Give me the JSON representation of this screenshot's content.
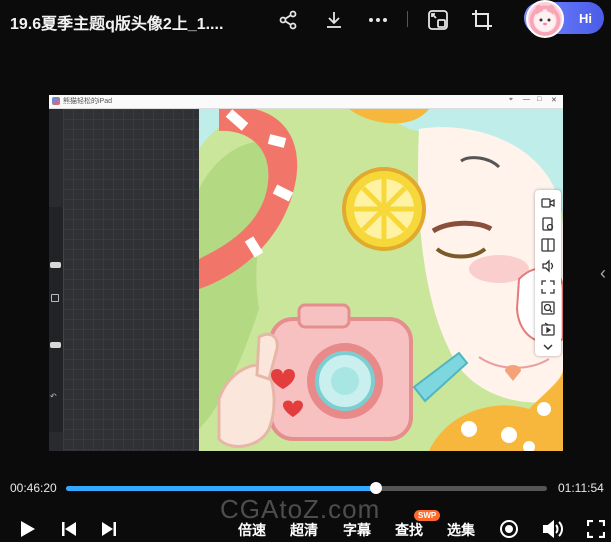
{
  "header": {
    "title": "19.6夏季主题q版头像2上_1....",
    "icons": [
      "share-icon",
      "download-icon",
      "more-icon",
      "pip-icon",
      "fullscreen-window-icon"
    ],
    "assistant_label": "Hi"
  },
  "video": {
    "window_title": "熊猫轻松的iPad",
    "window_controls": [
      "⌖",
      "—",
      "□",
      "✕"
    ]
  },
  "side_toolbar": {
    "icons": [
      "video-record-icon",
      "screenshot-icon",
      "split-icon",
      "volume-icon",
      "expand-icon",
      "zoom-icon",
      "tv-icon",
      "chevron-down-icon"
    ]
  },
  "progress": {
    "current": "00:46:20",
    "total": "01:11:54",
    "fraction": 0.645
  },
  "controls": {
    "speed_label": "倍速",
    "quality_label": "超清",
    "subtitle_label": "字幕",
    "search_label": "查找",
    "search_badge": "SWP",
    "episodes_label": "选集"
  },
  "watermark": "CGAtoZ.com",
  "colors": {
    "accent": "#35a8ff",
    "badge": "#ff6a2a",
    "assistant": "#5a6df2"
  }
}
